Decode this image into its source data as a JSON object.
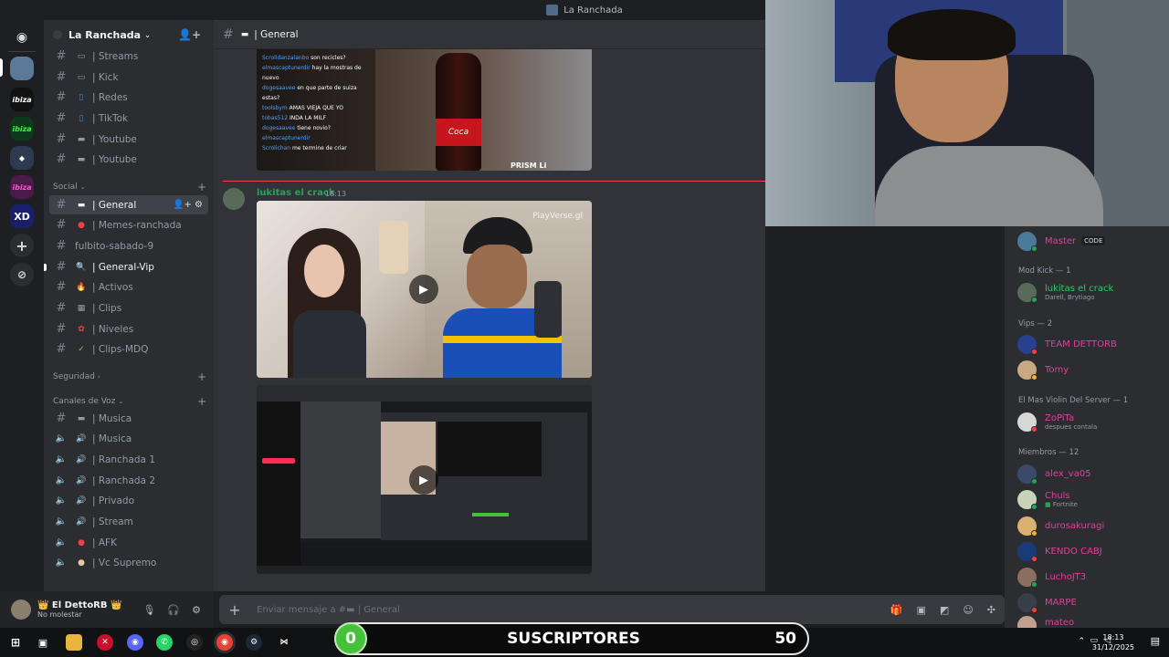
{
  "window": {
    "title": "La Ranchada"
  },
  "server": {
    "name": "La Ranchada"
  },
  "channels": [
    {
      "label": "| Streams",
      "emoji": "▭"
    },
    {
      "label": "| Kick",
      "emoji": "▭"
    },
    {
      "label": "| Redes",
      "emoji": "▯"
    },
    {
      "label": "| TikTok",
      "emoji": "▯"
    },
    {
      "label": "| Youtube",
      "emoji": "▬"
    },
    {
      "label": "| Youtube",
      "emoji": "▬"
    }
  ],
  "categories": {
    "social": "Social",
    "seguridad": "Seguridad",
    "voz": "Canales de Voz"
  },
  "social_channels": [
    {
      "label": "| General",
      "emoji": "▬"
    },
    {
      "label": "| Memes-ranchada",
      "emoji": "●"
    },
    {
      "label": "fulbito-sabado-9",
      "emoji": ""
    },
    {
      "label": "| General-Vip",
      "emoji": "🔍"
    },
    {
      "label": "| Activos",
      "emoji": "🔥"
    },
    {
      "label": "| Clips",
      "emoji": "▦"
    },
    {
      "label": "| Niveles",
      "emoji": "✿"
    },
    {
      "label": "| Clips-MDQ",
      "emoji": "✓"
    }
  ],
  "voice_channels": [
    {
      "label": "| Musica",
      "emoji": "▬",
      "type": "text"
    },
    {
      "label": "| Musica",
      "emoji": "🔊",
      "type": "voice"
    },
    {
      "label": "| Ranchada 1",
      "emoji": "🔊",
      "type": "voice"
    },
    {
      "label": "| Ranchada 2",
      "emoji": "🔊",
      "type": "voice"
    },
    {
      "label": "| Privado",
      "emoji": "🔊",
      "type": "voice"
    },
    {
      "label": "| Stream",
      "emoji": "🔊",
      "type": "voice"
    },
    {
      "label": "| AFK",
      "emoji": "●",
      "type": "voice"
    },
    {
      "label": "| Vc Supremo",
      "emoji": "●",
      "type": "voice"
    }
  ],
  "user": {
    "name": "👑 El DettoRB 👑",
    "status": "No molestar"
  },
  "chat": {
    "channel": "| General",
    "message": {
      "author": "lukitas el crack",
      "time": "18:13"
    },
    "composer_placeholder": "Enviar mensaje a #▬ | General",
    "prev_image_chat": [
      {
        "user": "Scrolidanzalanbo",
        "text": "son recicles?"
      },
      {
        "user": "elmascaptunerdir",
        "text": "hay la mostras de nuevo"
      },
      {
        "user": "dogesaavee",
        "text": "en que parte de suiza estas?"
      },
      {
        "user": "toolsbym",
        "text": "AMAS VIEJA QUE YO"
      },
      {
        "user": "tobas512",
        "text": "INDA LA MILF"
      },
      {
        "user": "dogesaavee",
        "text": "tiene novio?"
      },
      {
        "user": "elmascaptunerdir",
        "text": ""
      },
      {
        "user": "Scrolichan",
        "text": "me termine de criar"
      }
    ],
    "watermark": "PlayVerse.gl",
    "prism_text": "PRISM Li"
  },
  "members": {
    "top": {
      "name": "Master",
      "tag": "CODE"
    },
    "groups": [
      {
        "title": "Mod Kick — 1",
        "members": [
          {
            "name": "lukitas el crack",
            "sub": "Darell, Brytiago",
            "color": "#23d160"
          }
        ]
      },
      {
        "title": "Vips — 2",
        "members": [
          {
            "name": "TEAM DETTORB",
            "sub": "",
            "color": "#e0409a"
          },
          {
            "name": "Tomy",
            "sub": "",
            "color": "#e0409a"
          }
        ]
      },
      {
        "title": "El Mas Violin Del Server — 1",
        "members": [
          {
            "name": "ZoPiTa",
            "sub": "despues contala",
            "color": "#e0409a"
          }
        ]
      },
      {
        "title": "Miembros — 12",
        "members": [
          {
            "name": "alex_va05",
            "sub": "",
            "color": "#e0409a"
          },
          {
            "name": "Chuls",
            "sub": "Fortnite",
            "color": "#e0409a"
          },
          {
            "name": "durosakuragi",
            "sub": "",
            "color": "#e0409a"
          },
          {
            "name": "KENDO CABJ",
            "sub": "",
            "color": "#e0409a"
          },
          {
            "name": "LuchoJT3",
            "sub": "",
            "color": "#e0409a"
          },
          {
            "name": "MARPE",
            "sub": "",
            "color": "#e0409a"
          },
          {
            "name": "mateo",
            "sub": "",
            "color": "#e0409a"
          }
        ]
      }
    ]
  },
  "subs_bar": {
    "current": "0",
    "label": "SUSCRIPTORES",
    "goal": "50",
    "progress": 0
  },
  "taskbar": {
    "time": "18:13",
    "date": "31/12/2025"
  },
  "colors": {
    "accent": "#5865f2",
    "online": "#23a559",
    "mod": "#23d160",
    "member": "#e0409a",
    "unread": "#f23f43"
  }
}
